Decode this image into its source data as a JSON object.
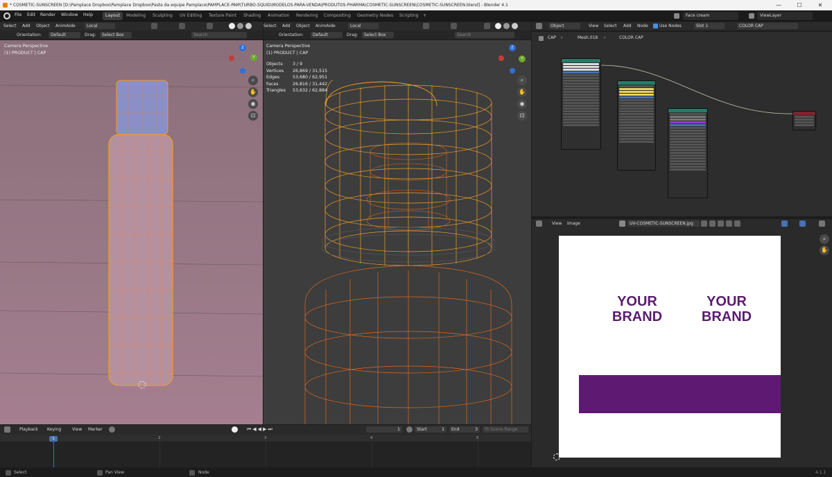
{
  "window": {
    "title": "* COSMETIC-SUNSCREEN [D:\\Pamplace Dropbox\\Pamplace Dropbox\\Pasta da equipe Pamplace\\PAMPLACE-PAM\\TURBO-SQUID\\MODELOS-PARA-VENDA\\PRODUTOS-PHARMA\\COSMETIC-SUNSCREEN\\COSMETIC-SUNSCREEN.blend] - Blender 4.1",
    "minimize": "—",
    "maximize": "☐",
    "close": "✕"
  },
  "menu": [
    "File",
    "Edit",
    "Render",
    "Window",
    "Help"
  ],
  "workspaces": [
    "Layout",
    "Modeling",
    "Sculpting",
    "UV Editing",
    "Texture Paint",
    "Shading",
    "Animation",
    "Rendering",
    "Compositing",
    "Geometry Nodes",
    "Scripting",
    "+"
  ],
  "scene": {
    "name": "Face cream",
    "view_layer": "ViewLayer"
  },
  "left_viewport": {
    "header": {
      "select": "Select",
      "add": "Add",
      "object": "Object",
      "animaide": "AnimAide",
      "transform": "Local"
    },
    "tool_header": {
      "orientation_label": "Orientation:",
      "orientation": "Default",
      "drag_label": "Drag:",
      "drag": "Select Box",
      "search_placeholder": "Search"
    },
    "camera_label": "Camera Perspective",
    "object_label": "(1) PRODUCT | CAP"
  },
  "mid_viewport": {
    "header": {
      "select": "Select",
      "add": "Add",
      "object": "Object",
      "animaide": "AnimAide",
      "transform": "Local"
    },
    "tool_header": {
      "orientation_label": "Orientation:",
      "orientation": "Default",
      "drag_label": "Drag:",
      "drag": "Select Box",
      "search_placeholder": "Search"
    },
    "camera_label": "Camera Perspective",
    "object_label": "(1) PRODUCT | CAP",
    "stats": [
      {
        "label": "Objects",
        "value": "3 / 9"
      },
      {
        "label": "Vertices",
        "value": "26,869 / 31,515"
      },
      {
        "label": "Edges",
        "value": "53,680 / 62,951"
      },
      {
        "label": "Faces",
        "value": "26,816 / 31,442"
      },
      {
        "label": "Triangles",
        "value": "53,632 / 62,884"
      }
    ]
  },
  "gizmo_axes": {
    "z": "Z",
    "y": "Y"
  },
  "node_editor": {
    "header": {
      "object": "Object",
      "view": "View",
      "select": "Select",
      "add": "Add",
      "node": "Node",
      "use_nodes": "Use Nodes",
      "slot": "Slot 1",
      "material": "COLOR CAP"
    },
    "breadcrumb": [
      "CAP",
      "Mesh.018",
      "COLOR CAP"
    ],
    "colors": {
      "node_header": "#1e7f67",
      "link": "#c8c8b0",
      "output_header": "#7a2530"
    }
  },
  "image_editor": {
    "header": {
      "view": "View",
      "image": "Image",
      "image_name": "UV-COSMETIC-SUNSCREEN.jpg"
    },
    "texture": {
      "brand_left": "YOUR\nBRAND",
      "brand_right": "YOUR\nBRAND",
      "bar_color": "#5e1a72",
      "text_color": "#5a1d6e"
    }
  },
  "timeline": {
    "header": {
      "playback": "Playback",
      "keying": "Keying",
      "view": "View",
      "marker": "Marker",
      "current_frame": "1",
      "start_label": "Start",
      "start": "1",
      "end_label": "End",
      "end": "3",
      "to_scene_range": "To Scene Range"
    },
    "ticks": [
      "1",
      "2",
      "3",
      "4",
      "5"
    ]
  },
  "statusbar": {
    "left": "Select",
    "middle": "Pan View",
    "right": "Node",
    "version": "4.1.1"
  }
}
